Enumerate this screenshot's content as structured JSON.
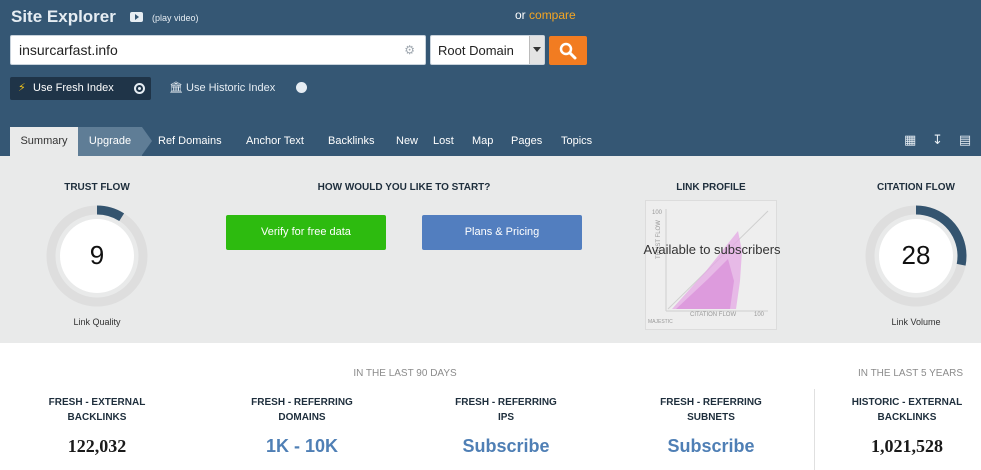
{
  "header": {
    "title": "Site Explorer",
    "play_video": "(play video)",
    "or_text": "or",
    "compare_text": "compare",
    "search_value": "insurcarfast.info",
    "domain_scope": "Root Domain",
    "fresh_index_label": "Use Fresh Index",
    "historic_index_label": "Use Historic Index",
    "selected_index": "fresh"
  },
  "tabs": [
    {
      "label": "Summary",
      "active": true
    },
    {
      "label": "Upgrade"
    },
    {
      "label": "Ref Domains"
    },
    {
      "label": "Anchor Text"
    },
    {
      "label": "Backlinks"
    },
    {
      "label": "New"
    },
    {
      "label": "Lost"
    },
    {
      "label": "Map"
    },
    {
      "label": "Pages"
    },
    {
      "label": "Topics"
    }
  ],
  "tool_icons": [
    "add-to-bucket-icon",
    "download-icon",
    "report-icon"
  ],
  "summary": {
    "trust_flow": {
      "title": "TRUST FLOW",
      "value": "9",
      "caption": "Link Quality",
      "level": 9
    },
    "start": {
      "title": "HOW WOULD YOU LIKE TO START?",
      "verify_label": "Verify for free data",
      "plans_label": "Plans & Pricing"
    },
    "link_profile": {
      "title": "LINK PROFILE",
      "overlay": "Available to subscribers",
      "x_axis": "CITATION FLOW",
      "y_axis": "TRUST FLOW",
      "x_max": "100",
      "y_max": "100",
      "brand": "MAJESTIC"
    },
    "citation_flow": {
      "title": "CITATION FLOW",
      "value": "28",
      "caption": "Link Volume",
      "level": 28
    }
  },
  "stats": {
    "period_90": "IN THE LAST 90 DAYS",
    "period_5y": "IN THE LAST 5 YEARS",
    "items": [
      {
        "label_1": "FRESH - EXTERNAL",
        "label_2": "BACKLINKS",
        "value": "122,032"
      },
      {
        "label_1": "FRESH - REFERRING",
        "label_2": "DOMAINS",
        "value": "1K - 10K"
      },
      {
        "label_1": "FRESH - REFERRING",
        "label_2": "IPS",
        "value": "Subscribe"
      },
      {
        "label_1": "FRESH - REFERRING",
        "label_2": "SUBNETS",
        "value": "Subscribe"
      },
      {
        "label_1": "HISTORIC - EXTERNAL",
        "label_2": "BACKLINKS",
        "value": "1,021,528"
      }
    ]
  },
  "colors": {
    "header_bg": "#355774",
    "accent_orange": "#f27c21",
    "verify_green": "#2dbb0f",
    "plans_blue": "#527ebf",
    "gauge_dark": "#34546f"
  }
}
